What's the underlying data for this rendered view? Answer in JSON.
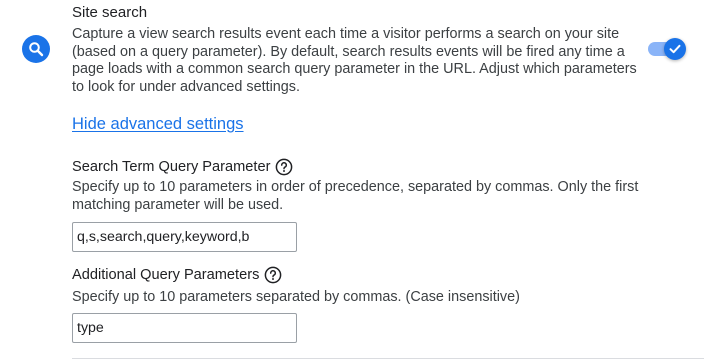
{
  "site_search": {
    "title": "Site search",
    "icon": "search-icon",
    "accent_color": "#1a73e8",
    "description": "Capture a view search results event each time a visitor performs a search on your site (based on a query parameter). By default, search results events will be fired any time a page loads with a common search query parameter in the URL. Adjust which parameters to look for under advanced settings.",
    "enabled": true
  },
  "advanced_link": "Hide advanced settings",
  "search_term": {
    "label": "Search Term Query Parameter",
    "description": "Specify up to 10 parameters in order of precedence, separated by commas. Only the first matching parameter will be used.",
    "value": "q,s,search,query,keyword,b"
  },
  "additional": {
    "label": "Additional Query Parameters",
    "description": "Specify up to 10 parameters separated by commas. (Case insensitive)",
    "value": "type"
  }
}
